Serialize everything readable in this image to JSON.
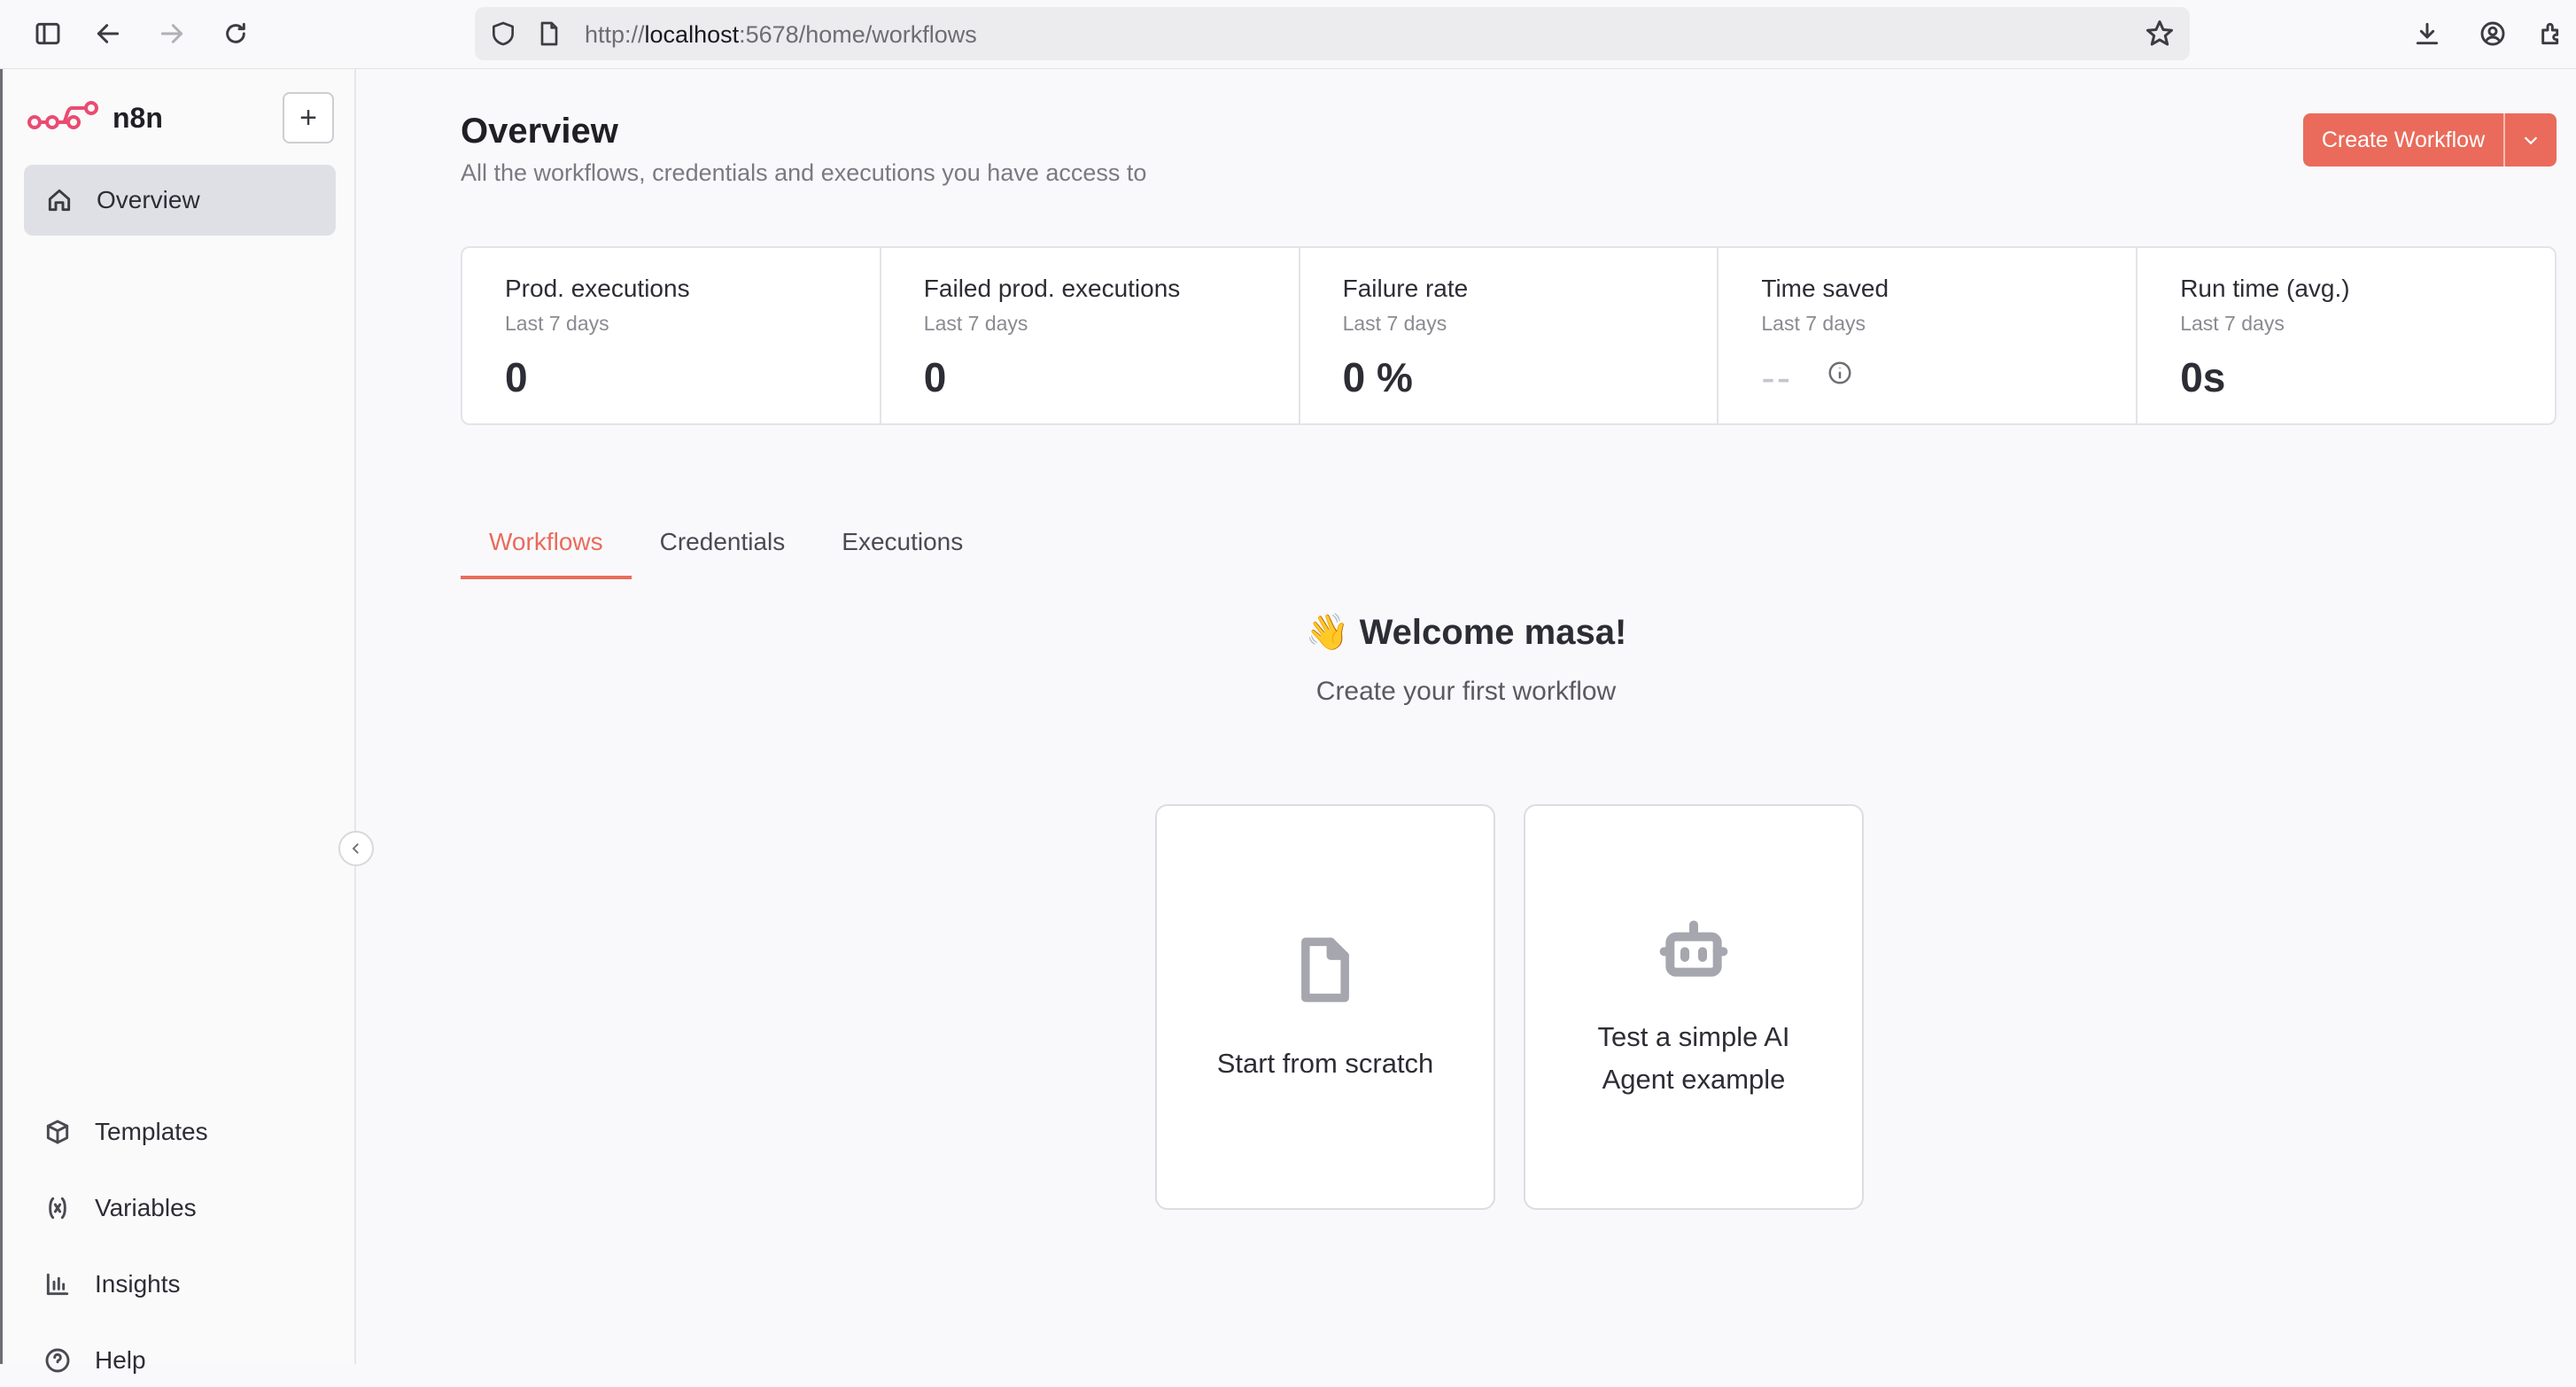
{
  "browser": {
    "url_prefix": "http://",
    "url_host": "localhost",
    "url_rest": ":5678/home/workflows"
  },
  "sidebar": {
    "brand": "n8n",
    "add_label": "+",
    "overview_label": "Overview",
    "bottom_items": [
      {
        "label": "Templates",
        "icon": "box-icon"
      },
      {
        "label": "Variables",
        "icon": "variable-icon"
      },
      {
        "label": "Insights",
        "icon": "chart-icon"
      },
      {
        "label": "Help",
        "icon": "help-icon"
      }
    ]
  },
  "header": {
    "title": "Overview",
    "subtitle": "All the workflows, credentials and executions you have access to",
    "create_label": "Create Workflow"
  },
  "stats": [
    {
      "label": "Prod. executions",
      "sub": "Last 7 days",
      "value": "0"
    },
    {
      "label": "Failed prod. executions",
      "sub": "Last 7 days",
      "value": "0"
    },
    {
      "label": "Failure rate",
      "sub": "Last 7 days",
      "value": "0 %"
    },
    {
      "label": "Time saved",
      "sub": "Last 7 days",
      "value": "--"
    },
    {
      "label": "Run time (avg.)",
      "sub": "Last 7 days",
      "value": "0s"
    }
  ],
  "tabs": [
    {
      "label": "Workflows",
      "active": true
    },
    {
      "label": "Credentials",
      "active": false
    },
    {
      "label": "Executions",
      "active": false
    }
  ],
  "welcome": {
    "title": "👋 Welcome masa!",
    "subtitle": "Create your first workflow"
  },
  "cards": [
    {
      "label": "Start from scratch"
    },
    {
      "label": "Test a simple AI Agent example"
    }
  ],
  "colors": {
    "accent": "#ea6b5b",
    "sidebar_active": "#dfe0e6"
  }
}
